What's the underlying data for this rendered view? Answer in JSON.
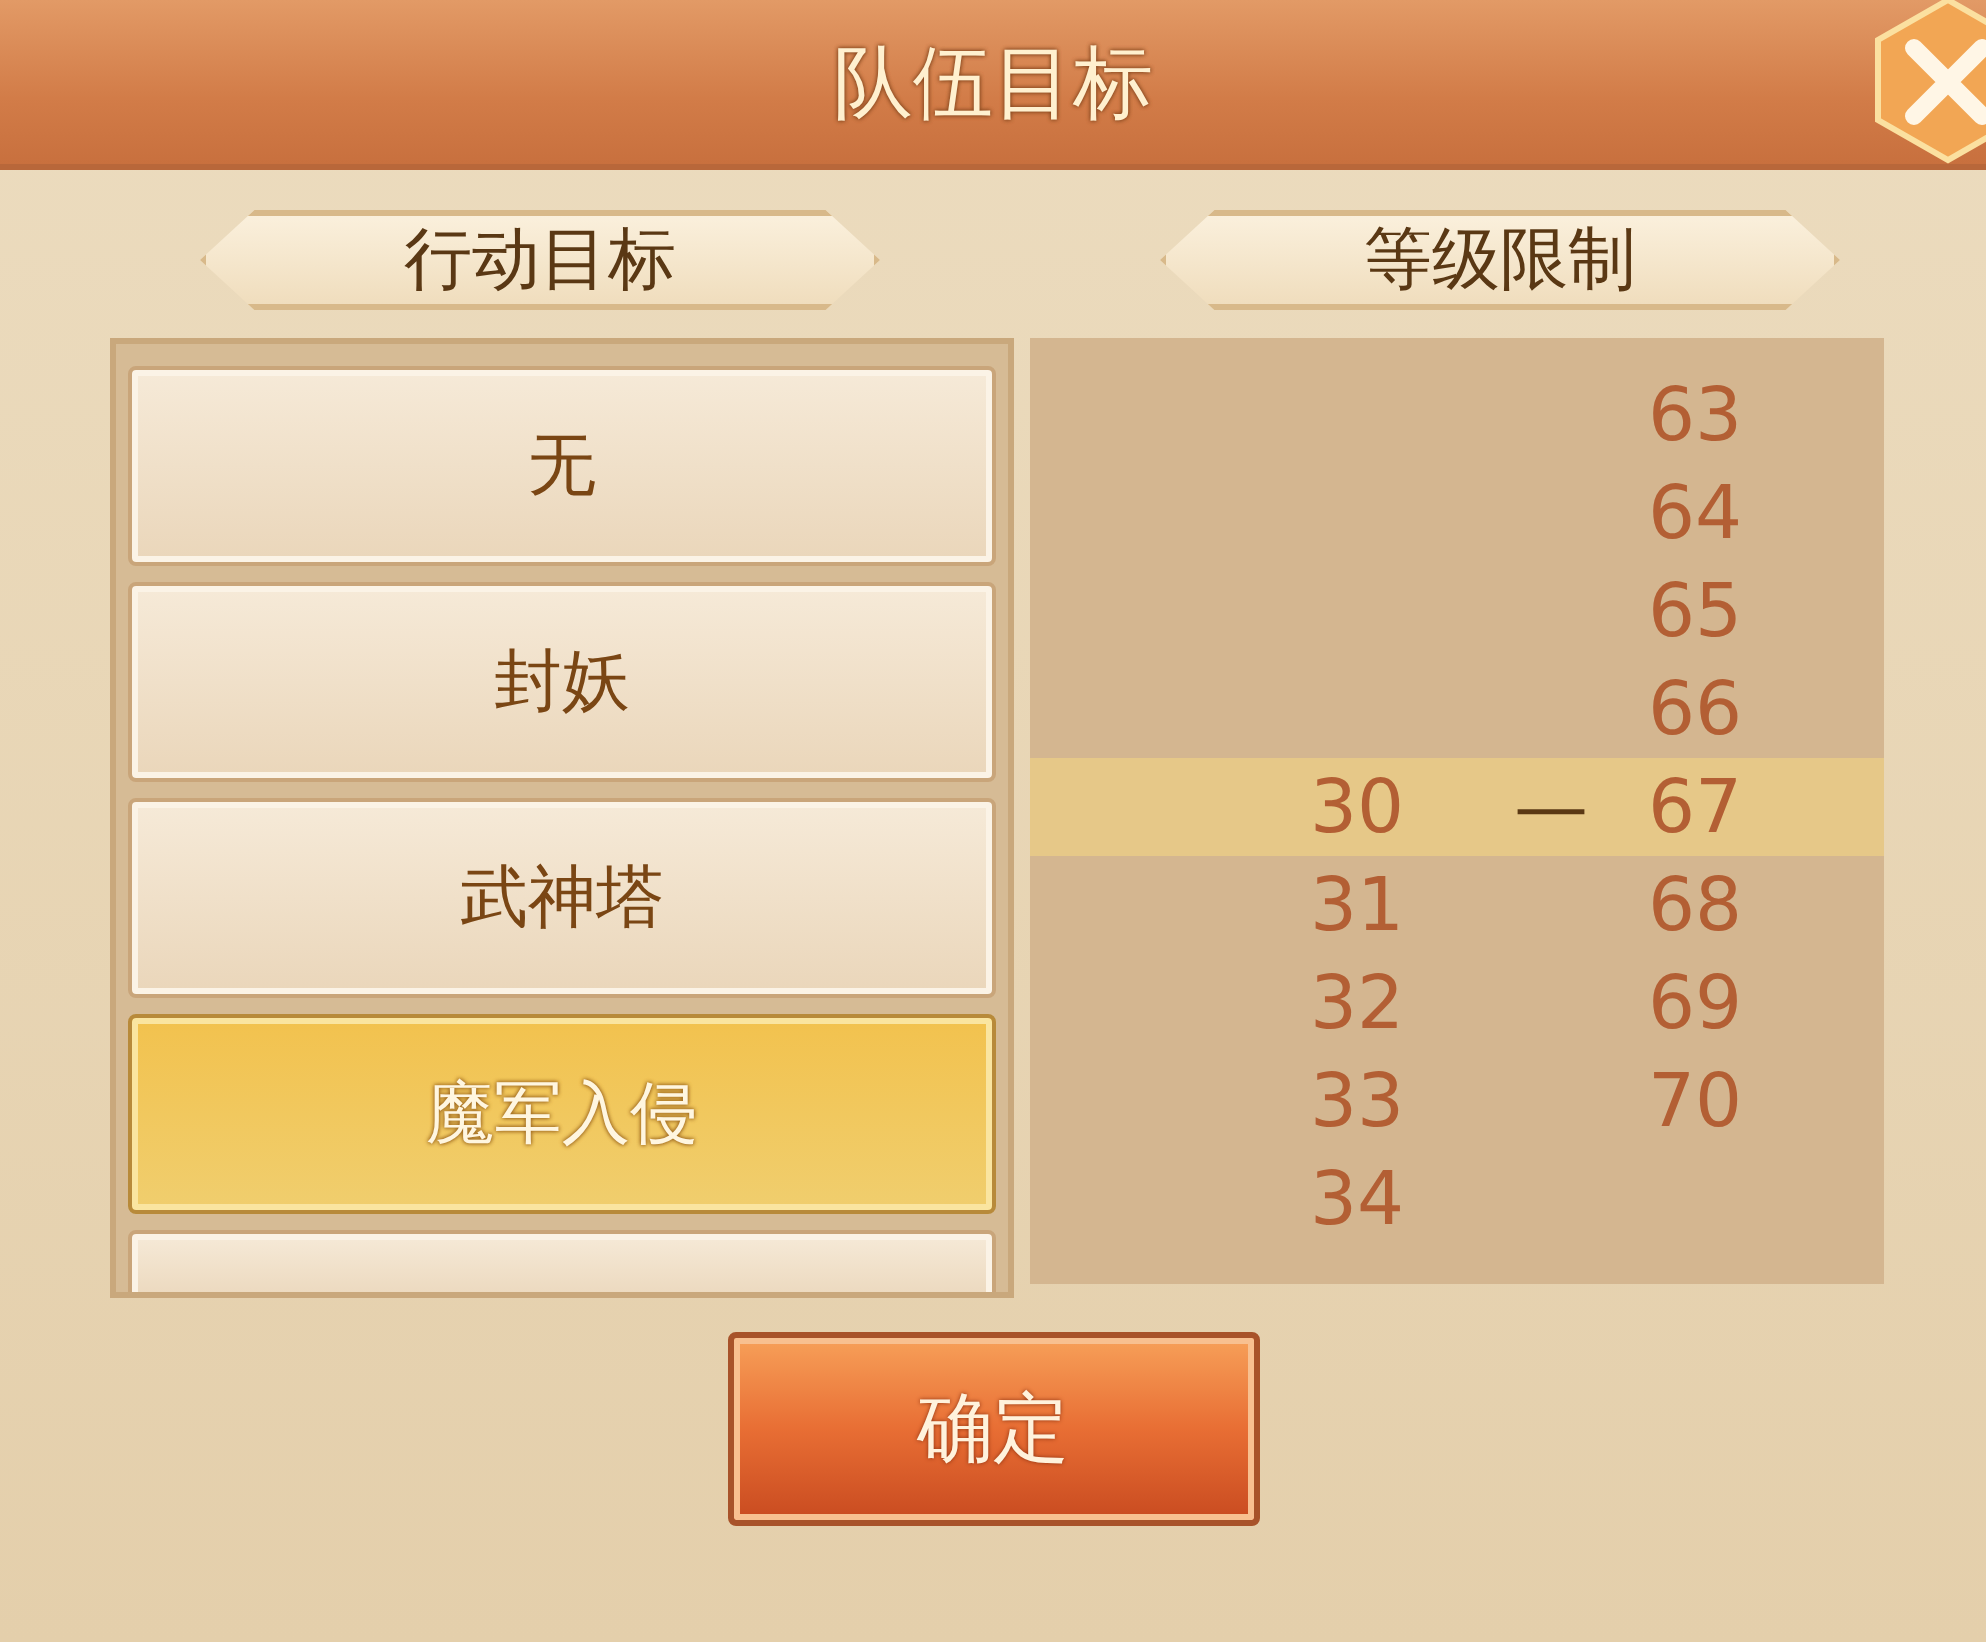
{
  "window": {
    "title": "队伍目标"
  },
  "sections": [
    {
      "title": "行动目标"
    },
    {
      "title": "等级限制"
    }
  ],
  "goals": [
    {
      "label": "无",
      "selected": false
    },
    {
      "label": "封妖",
      "selected": false
    },
    {
      "label": "武神塔",
      "selected": false
    },
    {
      "label": "魔军入侵",
      "selected": true
    }
  ],
  "level_picker": {
    "separator": "—",
    "min": [
      {
        "value": "30",
        "selected": true
      },
      {
        "value": "31",
        "selected": false
      },
      {
        "value": "32",
        "selected": false
      },
      {
        "value": "33",
        "selected": false
      },
      {
        "value": "34",
        "selected": false
      }
    ],
    "max": [
      {
        "value": "63",
        "selected": false
      },
      {
        "value": "64",
        "selected": false
      },
      {
        "value": "65",
        "selected": false
      },
      {
        "value": "66",
        "selected": false
      },
      {
        "value": "67",
        "selected": true
      },
      {
        "value": "68",
        "selected": false
      },
      {
        "value": "69",
        "selected": false
      },
      {
        "value": "70",
        "selected": false
      }
    ]
  },
  "buttons": [
    {
      "label": "确定"
    }
  ]
}
